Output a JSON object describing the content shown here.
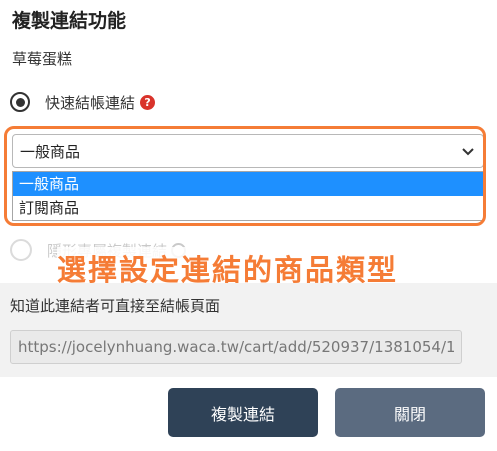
{
  "dialog": {
    "title": "複製連結功能",
    "product_name": "草莓蛋糕",
    "quick_checkout_label": "快速結帳連結",
    "help_icon_glyph": "?",
    "select_value": "一般商品",
    "dropdown_options": [
      "一般商品",
      "訂閱商品"
    ],
    "selected_option_index": 0,
    "second_radio_label": "隱形專屬複製連結",
    "annotation_text": "選擇設定連結的商品類型",
    "description": "知道此連結者可直接至結帳頁面",
    "url_value": "https://jocelynhuang.waca.tw/cart/add/520937/1381054/1",
    "copy_button": "複製連結",
    "close_button": "關閉"
  },
  "colors": {
    "highlight_orange": "#f57c36",
    "selected_blue": "#1e90ff",
    "copy_button_bg": "#2f4257",
    "close_button_bg": "#5b6b80",
    "help_red": "#d9332b"
  },
  "icons": [
    "radio-selected-icon",
    "help-icon",
    "chevron-down-icon",
    "radio-unselected-icon"
  ]
}
